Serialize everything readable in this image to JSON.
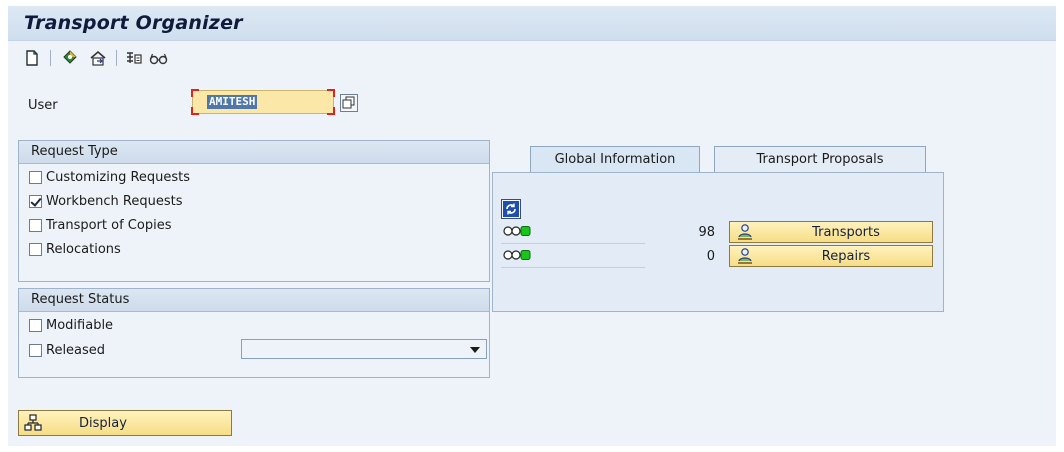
{
  "window": {
    "title": "Transport Organizer"
  },
  "toolbar": {
    "icons": [
      "new-document-icon",
      "requests-icon",
      "home-transport-icon",
      "tasks-icon",
      "glasses-icon"
    ]
  },
  "user": {
    "label": "User",
    "value": "AMITESH"
  },
  "request_type": {
    "title": "Request Type",
    "items": [
      {
        "label": "Customizing Requests",
        "checked": false
      },
      {
        "label": "Workbench Requests",
        "checked": true
      },
      {
        "label": "Transport of Copies",
        "checked": false
      },
      {
        "label": "Relocations",
        "checked": false
      }
    ]
  },
  "request_status": {
    "title": "Request Status",
    "items": [
      {
        "label": "Modifiable",
        "checked": false
      },
      {
        "label": "Released",
        "checked": false
      }
    ],
    "released_select": {
      "value": ""
    }
  },
  "tabs": {
    "active": "Global Information",
    "labels": [
      "Global Information",
      "Transport Proposals"
    ],
    "rows": [
      {
        "count": "98",
        "button": "Transports"
      },
      {
        "count": "0",
        "button": "Repairs"
      }
    ]
  },
  "display_button": {
    "label": "Display"
  },
  "colors": {
    "accent_yellow": "#f6dd86",
    "group_header": "#cddbeb",
    "selection_blue": "#4f77a8",
    "status_green": "#17c51b"
  }
}
